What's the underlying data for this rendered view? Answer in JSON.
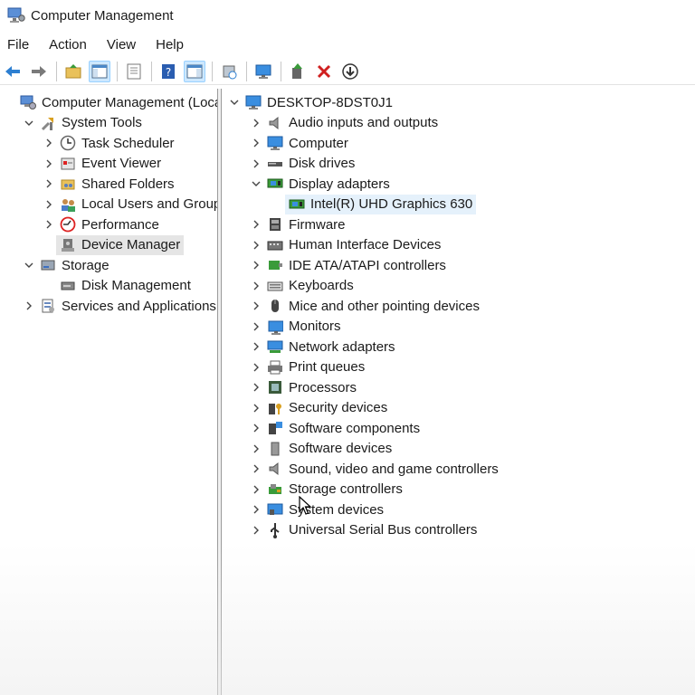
{
  "window": {
    "title": "Computer Management"
  },
  "menu": [
    "File",
    "Action",
    "View",
    "Help"
  ],
  "toolbar": [
    {
      "name": "back-arrow-icon"
    },
    {
      "name": "forward-arrow-icon"
    },
    {
      "sep": true
    },
    {
      "name": "up-folder-icon"
    },
    {
      "name": "show-hide-console-tree-icon",
      "sel": true
    },
    {
      "sep": true
    },
    {
      "name": "properties-icon"
    },
    {
      "sep": true
    },
    {
      "name": "help-icon"
    },
    {
      "name": "show-action-pane-icon",
      "sel": true
    },
    {
      "sep": true
    },
    {
      "name": "scan-hardware-icon"
    },
    {
      "sep": true
    },
    {
      "name": "monitor-icon"
    },
    {
      "sep": true
    },
    {
      "name": "update-driver-icon"
    },
    {
      "name": "uninstall-device-icon"
    },
    {
      "name": "download-icon"
    }
  ],
  "left_tree": [
    {
      "label": "Computer Management (Local",
      "icon": "computer-management-icon",
      "level": 0,
      "chev": ""
    },
    {
      "label": "System Tools",
      "icon": "system-tools-icon",
      "level": 1,
      "chev": "down"
    },
    {
      "label": "Task Scheduler",
      "icon": "task-scheduler-icon",
      "level": 2,
      "chev": "right"
    },
    {
      "label": "Event Viewer",
      "icon": "event-viewer-icon",
      "level": 2,
      "chev": "right"
    },
    {
      "label": "Shared Folders",
      "icon": "shared-folders-icon",
      "level": 2,
      "chev": "right"
    },
    {
      "label": "Local Users and Groups",
      "icon": "local-users-icon",
      "level": 2,
      "chev": "right"
    },
    {
      "label": "Performance",
      "icon": "performance-icon",
      "level": 2,
      "chev": "right"
    },
    {
      "label": "Device Manager",
      "icon": "device-manager-icon",
      "level": 2,
      "chev": "",
      "selected": true
    },
    {
      "label": "Storage",
      "icon": "storage-icon",
      "level": 1,
      "chev": "down"
    },
    {
      "label": "Disk Management",
      "icon": "disk-management-icon",
      "level": 2,
      "chev": ""
    },
    {
      "label": "Services and Applications",
      "icon": "services-applications-icon",
      "level": 1,
      "chev": "right"
    }
  ],
  "right_tree": [
    {
      "label": "DESKTOP-8DST0J1",
      "icon": "computer-icon",
      "level": 0,
      "chev": "down"
    },
    {
      "label": "Audio inputs and outputs",
      "icon": "speaker-icon",
      "level": 1,
      "chev": "right"
    },
    {
      "label": "Computer",
      "icon": "computer-icon",
      "level": 1,
      "chev": "right"
    },
    {
      "label": "Disk drives",
      "icon": "disk-drive-icon",
      "level": 1,
      "chev": "right"
    },
    {
      "label": "Display adapters",
      "icon": "display-adapter-icon",
      "level": 1,
      "chev": "down"
    },
    {
      "label": "Intel(R) UHD Graphics 630",
      "icon": "display-adapter-icon",
      "level": 2,
      "chev": "",
      "selected": true
    },
    {
      "label": "Firmware",
      "icon": "firmware-icon",
      "level": 1,
      "chev": "right"
    },
    {
      "label": "Human Interface Devices",
      "icon": "hid-icon",
      "level": 1,
      "chev": "right"
    },
    {
      "label": "IDE ATA/ATAPI controllers",
      "icon": "ide-controller-icon",
      "level": 1,
      "chev": "right"
    },
    {
      "label": "Keyboards",
      "icon": "keyboard-icon",
      "level": 1,
      "chev": "right"
    },
    {
      "label": "Mice and other pointing devices",
      "icon": "mouse-icon",
      "level": 1,
      "chev": "right"
    },
    {
      "label": "Monitors",
      "icon": "monitor-icon",
      "level": 1,
      "chev": "right"
    },
    {
      "label": "Network adapters",
      "icon": "network-adapter-icon",
      "level": 1,
      "chev": "right"
    },
    {
      "label": "Print queues",
      "icon": "printer-icon",
      "level": 1,
      "chev": "right"
    },
    {
      "label": "Processors",
      "icon": "processor-icon",
      "level": 1,
      "chev": "right"
    },
    {
      "label": "Security devices",
      "icon": "security-device-icon",
      "level": 1,
      "chev": "right"
    },
    {
      "label": "Software components",
      "icon": "software-components-icon",
      "level": 1,
      "chev": "right"
    },
    {
      "label": "Software devices",
      "icon": "software-devices-icon",
      "level": 1,
      "chev": "right"
    },
    {
      "label": "Sound, video and game controllers",
      "icon": "speaker-icon",
      "level": 1,
      "chev": "right"
    },
    {
      "label": "Storage controllers",
      "icon": "storage-controller-icon",
      "level": 1,
      "chev": "right"
    },
    {
      "label": "System devices",
      "icon": "system-devices-icon",
      "level": 1,
      "chev": "right"
    },
    {
      "label": "Universal Serial Bus controllers",
      "icon": "usb-icon",
      "level": 1,
      "chev": "right"
    }
  ]
}
